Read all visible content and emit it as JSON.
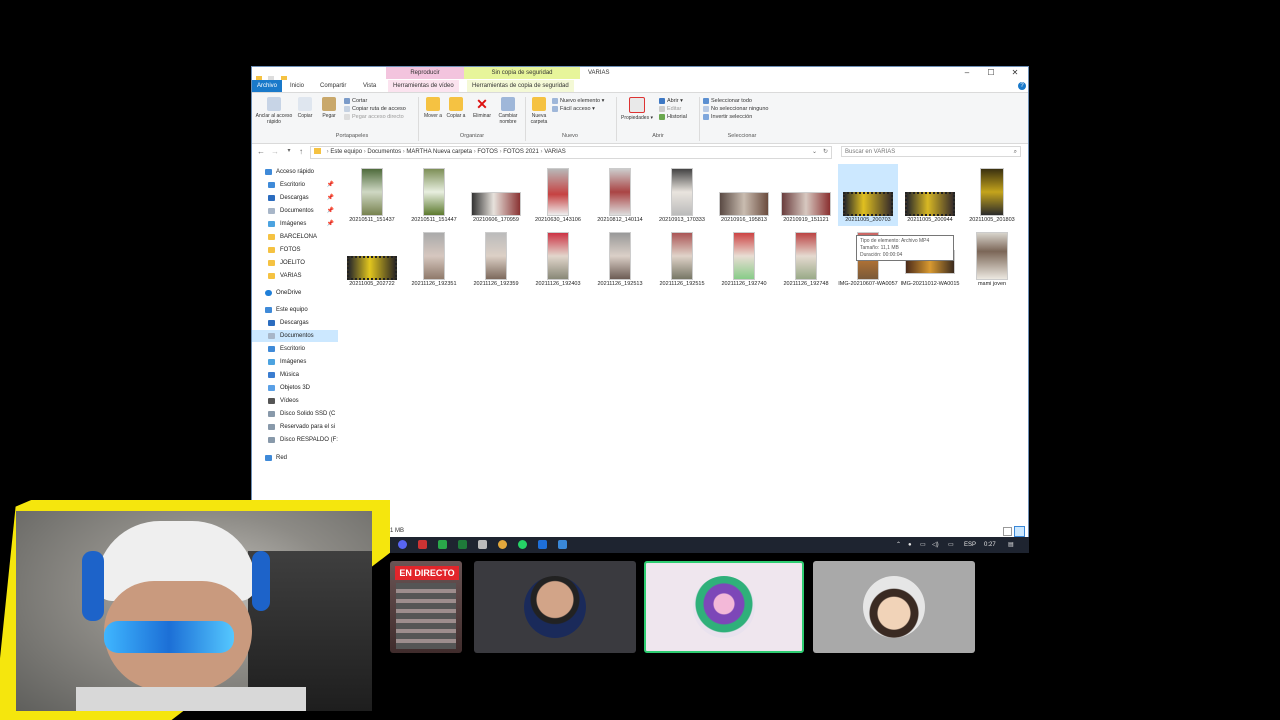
{
  "window": {
    "context_tabs": [
      "Reproducir",
      "Sin copia de seguridad"
    ],
    "title": "VARIAS",
    "controls": [
      "–",
      "☐",
      "✕"
    ],
    "ribbon_tabs": [
      "Archivo",
      "Inicio",
      "Compartir",
      "Vista",
      "Herramientas de vídeo",
      "Herramientas de copia de seguridad"
    ],
    "ribbon": {
      "anclar": "Anclar al acceso rápido",
      "copiar": "Copiar",
      "pegar": "Pegar",
      "cortar": "Cortar",
      "copiar_ruta": "Copiar ruta de acceso",
      "pegar_acceso": "Pegar acceso directo",
      "mover": "Mover a",
      "copiar_a": "Copiar a",
      "eliminar": "Eliminar",
      "cambiar_nombre": "Cambiar nombre",
      "nueva_carpeta": "Nueva carpeta",
      "nuevo_elemento": "Nuevo elemento",
      "facil_acceso": "Fácil acceso",
      "propiedades": "Propiedades",
      "abrir": "Abrir",
      "editar": "Editar",
      "historial": "Historial",
      "sel_todo": "Seleccionar todo",
      "sel_ninguno": "No seleccionar ninguno",
      "invertir": "Invertir selección",
      "groups": [
        "Portapapeles",
        "Organizar",
        "Nuevo",
        "Abrir",
        "Seleccionar"
      ]
    },
    "breadcrumb": [
      "Este equipo",
      "Documentos",
      "MARTHA Nueva carpeta",
      "FOTOS",
      "FOTOS 2021",
      "VARIAS"
    ],
    "search_placeholder": "Buscar en VARIAS",
    "nav": [
      "Acceso rápido",
      "Escritorio",
      "Descargas",
      "Documentos",
      "Imágenes",
      "BARCELONA",
      "FOTOS",
      "JOELITO",
      "VARIAS",
      "OneDrive",
      "Este equipo",
      "Descargas",
      "Documentos",
      "Escritorio",
      "Imágenes",
      "Música",
      "Objetos 3D",
      "Vídeos",
      "Disco Solido SSD (C",
      "Reservado para el si",
      "Disco RESPALDO (F:",
      "Red"
    ],
    "files_row1": [
      "20210511_151437",
      "20210511_151447",
      "20210606_170959",
      "20210630_143106",
      "20210812_140114",
      "20210913_170333",
      "20210916_195813",
      "20210919_151121",
      "20211005_200703",
      "20211005_200944",
      "20211005_201803"
    ],
    "files_row2": [
      "20211005_202722",
      "20211126_192351",
      "20211126_192359",
      "20211126_192403",
      "20211126_192513",
      "20211126_192515",
      "20211126_192740",
      "20211126_192748",
      "IMG-20210607-WA0057",
      "IMG-20211012-WA0015",
      "mami joven"
    ],
    "tooltip": {
      "line1": "Tipo de elemento: Archivo MP4",
      "line2": "Tamaño: 11,1 MB",
      "line3": "Duración: 00:00:04"
    },
    "status": "1 MB"
  },
  "taskbar": {
    "lang": "ESP",
    "time": "0:27"
  },
  "stream": {
    "live_label": "EN DIRECTO"
  },
  "colors": {
    "accent": "#1979ca",
    "selection": "#cce8ff",
    "live": "#e2252b",
    "stream_yellow": "#f5e60d",
    "active_tile_border": "#2ecc71"
  }
}
